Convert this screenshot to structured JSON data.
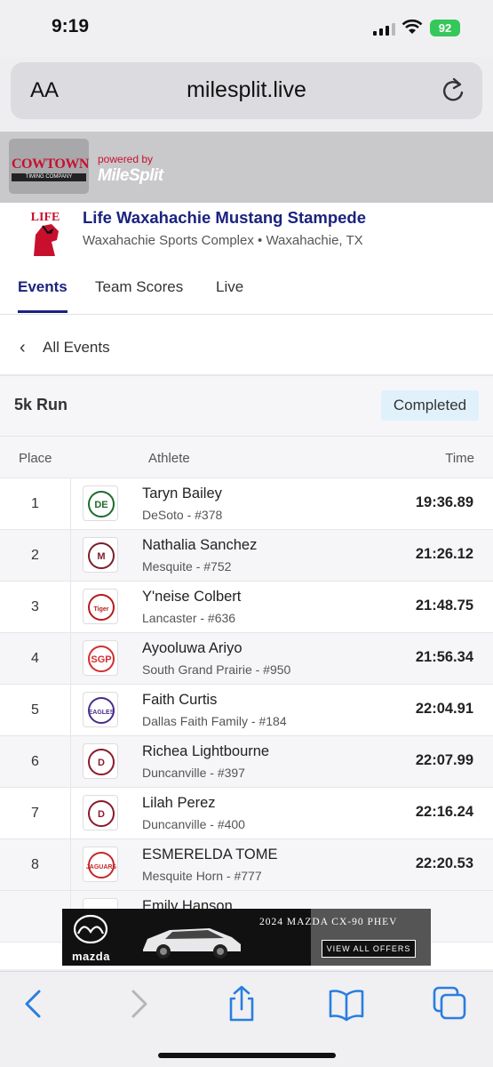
{
  "status_bar": {
    "time": "9:19",
    "battery": "92"
  },
  "browser": {
    "text_size_label": "AA",
    "url": "milesplit.live"
  },
  "header": {
    "sponsor_line1": "COWTOWN",
    "sponsor_line2": "TIMING COMPANY",
    "powered_by": "powered by",
    "brand": "MileSplit"
  },
  "meet": {
    "logo_text": "LIFE",
    "title": "Life Waxahachie Mustang Stampede",
    "location": "Waxahachie Sports Complex • Waxahachie, TX"
  },
  "tabs": [
    {
      "label": "Events",
      "active": true
    },
    {
      "label": "Team Scores",
      "active": false
    },
    {
      "label": "Live",
      "active": false
    }
  ],
  "back_label": "All Events",
  "event": {
    "name": "5k Run",
    "status": "Completed"
  },
  "table": {
    "headers": {
      "place": "Place",
      "athlete": "Athlete",
      "time": "Time"
    },
    "rows": [
      {
        "place": "1",
        "name": "Taryn Bailey",
        "team": "DeSoto - #378",
        "time": "19:36.89",
        "logo": "DE",
        "logo_color": "#1e6b2e"
      },
      {
        "place": "2",
        "name": "Nathalia Sanchez",
        "team": "Mesquite - #752",
        "time": "21:26.12",
        "logo": "M",
        "logo_color": "#7a1f2b"
      },
      {
        "place": "3",
        "name": "Y'neise Colbert",
        "team": "Lancaster - #636",
        "time": "21:48.75",
        "logo": "Tiger",
        "logo_color": "#b71c1c"
      },
      {
        "place": "4",
        "name": "Ayooluwa Ariyo",
        "team": "South Grand Prairie - #950",
        "time": "21:56.34",
        "logo": "SGP",
        "logo_color": "#d32f2f"
      },
      {
        "place": "5",
        "name": "Faith Curtis",
        "team": "Dallas Faith Family - #184",
        "time": "22:04.91",
        "logo": "EAGLES",
        "logo_color": "#4a2c8a"
      },
      {
        "place": "6",
        "name": "Richea Lightbourne",
        "team": "Duncanville - #397",
        "time": "22:07.99",
        "logo": "D",
        "logo_color": "#8b1a2b"
      },
      {
        "place": "7",
        "name": "Lilah Perez",
        "team": "Duncanville - #400",
        "time": "22:16.24",
        "logo": "D",
        "logo_color": "#8b1a2b"
      },
      {
        "place": "8",
        "name": "ESMERELDA TOME",
        "team": "Mesquite Horn - #777",
        "time": "22:20.53",
        "logo": "JAGUARS",
        "logo_color": "#c62828"
      }
    ],
    "partial_row_name": "Emily Hanson"
  },
  "ad": {
    "title": "2024 MAZDA CX-90 PHEV",
    "button": "VIEW ALL OFFERS",
    "brand": "mazda"
  },
  "toolbar": {
    "icons": [
      "back-icon",
      "forward-icon",
      "share-icon",
      "bookmarks-icon",
      "tabs-icon"
    ]
  }
}
